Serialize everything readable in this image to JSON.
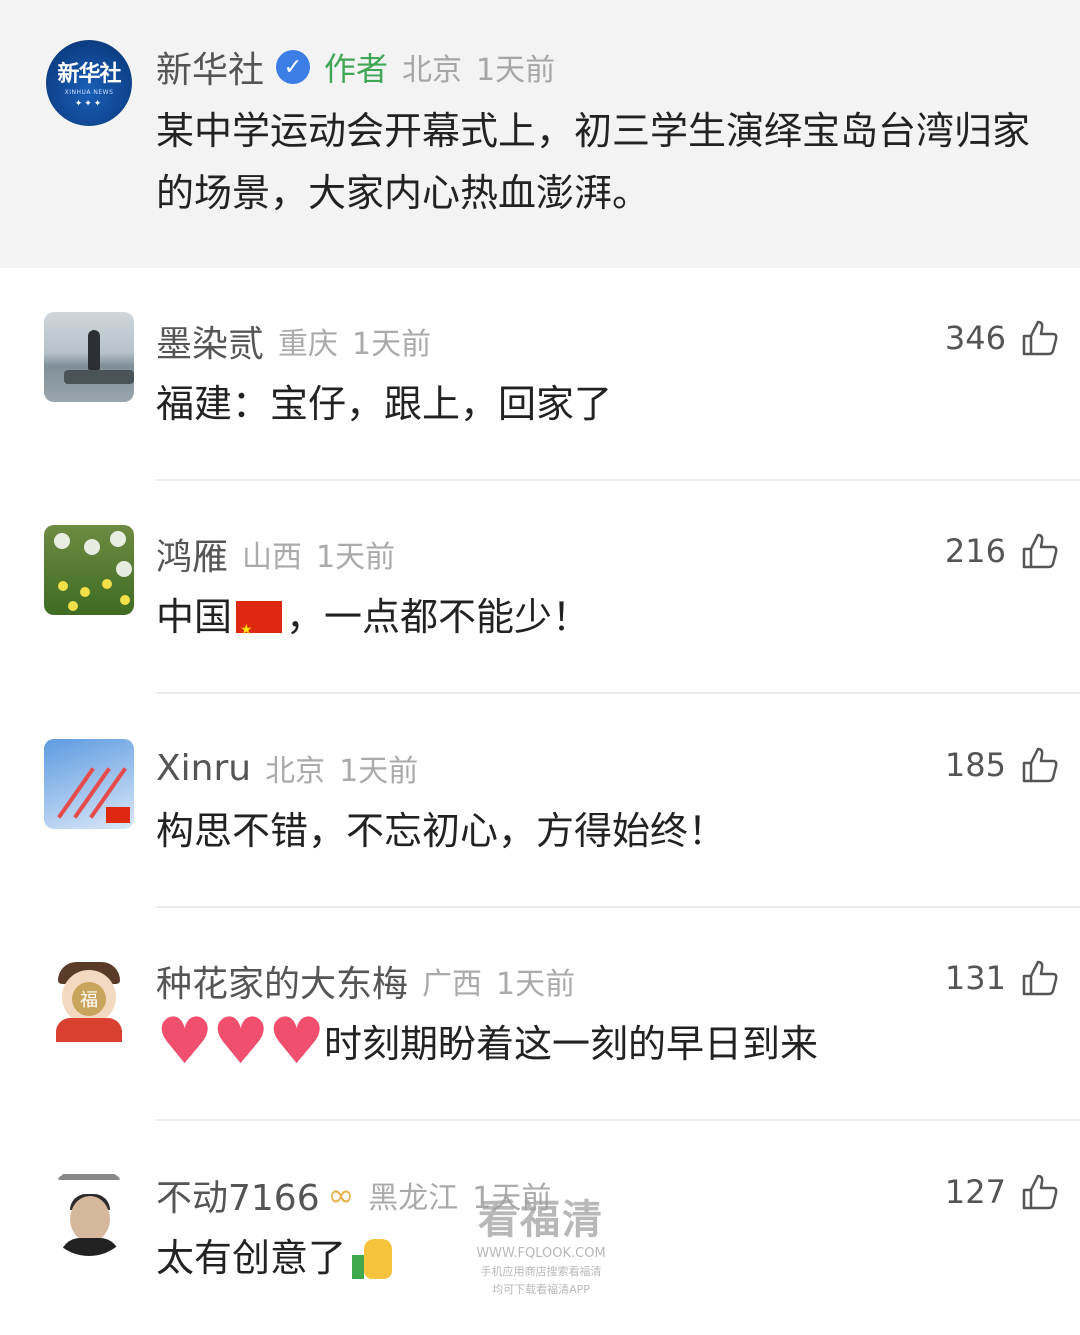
{
  "post": {
    "author": "新华社",
    "author_tag": "作者",
    "location": "北京",
    "time": "1天前",
    "text": "某中学运动会开幕式上，初三学生演绎宝岛台湾归家的场景，大家内心热血澎湃。",
    "avatar": {
      "logo_cn": "新华社",
      "logo_en": "XINHUA NEWS"
    }
  },
  "comments": [
    {
      "name": "墨染贰",
      "location": "重庆",
      "time": "1天前",
      "likes": "346",
      "text": "福建：宝仔，跟上，回家了"
    },
    {
      "name": "鸿雁",
      "location": "山西",
      "time": "1天前",
      "likes": "216",
      "text_before": "中国",
      "text_after": "，一点都不能少！"
    },
    {
      "name": "Xinru",
      "location": "北京",
      "time": "1天前",
      "likes": "185",
      "text": "构思不错，不忘初心，方得始终！"
    },
    {
      "name": "种花家的大东梅",
      "location": "广西",
      "time": "1天前",
      "likes": "131",
      "text": "时刻期盼着这一刻的早日到来",
      "avatar_glyph": "福"
    },
    {
      "name": "不动7166",
      "location": "黑龙江",
      "time": "1天前",
      "likes": "127",
      "text": "太有创意了"
    }
  ],
  "watermark": {
    "title": "看福清",
    "url": "WWW.FQLOOK.COM",
    "line1": "手机应用商店搜索看福清",
    "line2": "均可下载看福清APP"
  },
  "colors": {
    "author_tag": "#3fa656",
    "verified": "#3d7ee6",
    "meta": "#aaaaaa",
    "post_bg": "#f3f3f3"
  }
}
